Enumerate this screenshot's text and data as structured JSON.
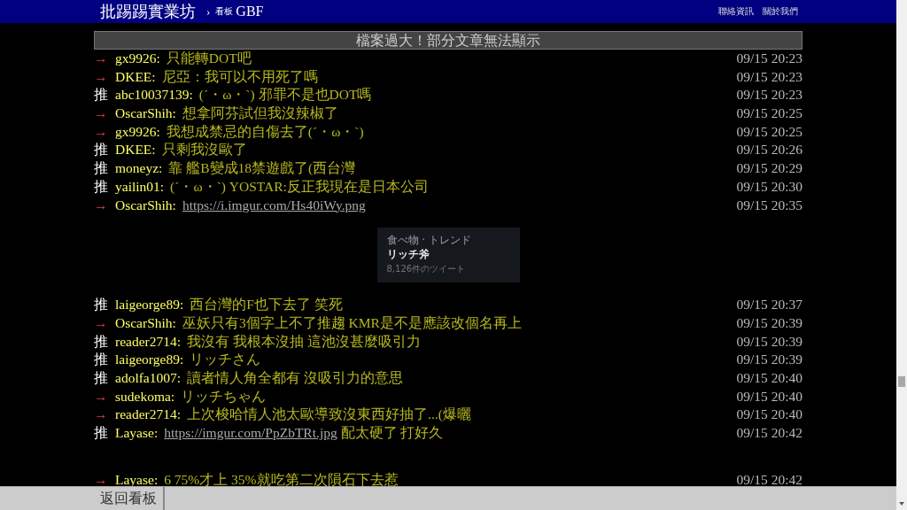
{
  "header": {
    "site": "批踢踢實業坊",
    "separator": "›",
    "board_label": "看板",
    "board": "GBF",
    "links": [
      "聯絡資訊",
      "關於我們"
    ]
  },
  "notice": "檔案過大！部分文章無法顯示",
  "comments": [
    {
      "kind": "arrow",
      "tag": "→",
      "user": "gx9926:",
      "content": [
        {
          "kind": "text",
          "text": "只能轉DOT吧"
        }
      ],
      "time": "09/15 20:23"
    },
    {
      "kind": "arrow",
      "tag": "→",
      "user": "DKEE:",
      "content": [
        {
          "kind": "text",
          "text": "尼亞：我可以不用死了嗎"
        }
      ],
      "time": "09/15 20:23"
    },
    {
      "kind": "push",
      "tag": "推",
      "user": "abc10037139:",
      "content": [
        {
          "kind": "text",
          "text": "(ˊ・ω・ˋ) 邪罪不是也DOT嗎"
        }
      ],
      "time": "09/15 20:23"
    },
    {
      "kind": "arrow",
      "tag": "→",
      "user": "OscarShih:",
      "content": [
        {
          "kind": "text",
          "text": "想拿阿芬試但我沒辣椒了"
        }
      ],
      "time": "09/15 20:25"
    },
    {
      "kind": "arrow",
      "tag": "→",
      "user": "gx9926:",
      "content": [
        {
          "kind": "text",
          "text": "我想成禁忌的自傷去了(ˊ・ω・ˋ)"
        }
      ],
      "time": "09/15 20:25"
    },
    {
      "kind": "push",
      "tag": "推",
      "user": "DKEE:",
      "content": [
        {
          "kind": "text",
          "text": "只剩我沒歐了"
        }
      ],
      "time": "09/15 20:26"
    },
    {
      "kind": "push",
      "tag": "推",
      "user": "moneyz:",
      "content": [
        {
          "kind": "text",
          "text": "靠 艦B變成18禁遊戲了(西台灣"
        }
      ],
      "time": "09/15 20:29"
    },
    {
      "kind": "push",
      "tag": "推",
      "user": "yailin01:",
      "content": [
        {
          "kind": "text",
          "text": "(ˊ・ω・ˋ) YOSTAR:反正我現在是日本公司"
        }
      ],
      "time": "09/15 20:30"
    },
    {
      "kind": "arrow",
      "tag": "→",
      "user": "OscarShih:",
      "content": [
        {
          "kind": "link",
          "text": "https://i.imgur.com/Hs40iWy.png"
        }
      ],
      "time": "09/15 20:35",
      "embed": {
        "category": "食べ物 · トレンド",
        "title": "リッチ斧",
        "count": "8,126件のツイート"
      }
    },
    {
      "kind": "push",
      "tag": "推",
      "user": "laigeorge89:",
      "content": [
        {
          "kind": "text",
          "text": "西台灣的F也下去了 笑死"
        }
      ],
      "time": "09/15 20:37"
    },
    {
      "kind": "arrow",
      "tag": "→",
      "user": "OscarShih:",
      "content": [
        {
          "kind": "text",
          "text": "巫妖只有3個字上不了推趨 KMR是不是應該改個名再上"
        }
      ],
      "time": "09/15 20:39"
    },
    {
      "kind": "push",
      "tag": "推",
      "user": "reader2714:",
      "content": [
        {
          "kind": "text",
          "text": "我沒有 我根本沒抽 這池沒甚麼吸引力"
        }
      ],
      "time": "09/15 20:39"
    },
    {
      "kind": "push",
      "tag": "推",
      "user": "laigeorge89:",
      "content": [
        {
          "kind": "text",
          "text": "リッチさん"
        }
      ],
      "time": "09/15 20:39"
    },
    {
      "kind": "push",
      "tag": "推",
      "user": "adolfa1007:",
      "content": [
        {
          "kind": "text",
          "text": "讀者情人角全都有 沒吸引力的意思"
        }
      ],
      "time": "09/15 20:40"
    },
    {
      "kind": "arrow",
      "tag": "→",
      "user": "sudekoma:",
      "content": [
        {
          "kind": "text",
          "text": "リッチちゃん"
        }
      ],
      "time": "09/15 20:40"
    },
    {
      "kind": "arrow",
      "tag": "→",
      "user": "reader2714:",
      "content": [
        {
          "kind": "text",
          "text": "上次梭哈情人池太歐導致沒東西好抽了...(爆曬"
        }
      ],
      "time": "09/15 20:40"
    },
    {
      "kind": "push",
      "tag": "推",
      "user": "Layase:",
      "content": [
        {
          "kind": "link",
          "text": "https://imgur.com/PpZbTRt.jpg"
        },
        {
          "kind": "text",
          "text": " 配太硬了 打好久"
        }
      ],
      "time": "09/15 20:42",
      "gap_after": true
    },
    {
      "kind": "arrow",
      "tag": "→",
      "user": "Layase:",
      "content": [
        {
          "kind": "text",
          "text": "6 75%才上 35%就吃第二次隕石下去惹"
        }
      ],
      "time": "09/15 20:42"
    }
  ],
  "footer": {
    "back_button": "返回看板"
  }
}
